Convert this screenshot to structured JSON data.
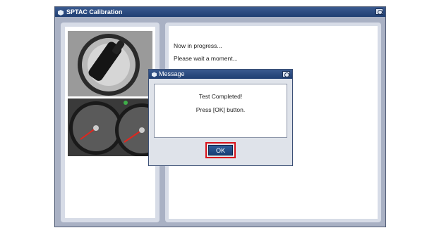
{
  "window": {
    "title": "SPTAC Calibration",
    "icon": "hexagon-app-icon"
  },
  "left_panel": {
    "images": [
      "ignition-key-cylinder",
      "instrument-cluster-gauges"
    ]
  },
  "status": {
    "line1": "Now in progress...",
    "line2": "Please wait a moment..."
  },
  "dialog": {
    "title": "Message",
    "line1": "Test Completed!",
    "line2": "Press [OK] button.",
    "ok_label": "OK",
    "highlight_color": "#d8131b"
  },
  "colors": {
    "titlebar": "#1f3e72",
    "frame": "#a9b1c4"
  }
}
